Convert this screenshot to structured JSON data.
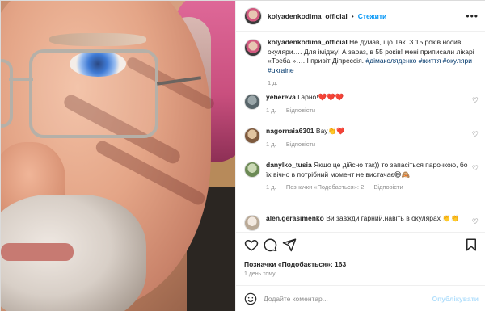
{
  "post": {
    "username": "kolyadenkodima_official",
    "follow_label": "Стежити",
    "caption_username": "kolyadenkodima_official",
    "caption_text": "Не думав, що Так. З 15 років носив окуляри…. Для іміджу! А зараз, в 55 років! мені приписали лікарі «Треба »…. І привіт Діпрессія.",
    "hashtags": "#дімаколяденко #життя #окуляри #ukraine",
    "caption_age": "1 д."
  },
  "comments": [
    {
      "username": "yehereva",
      "text": "Гарно!❤️❤️❤️",
      "age": "1 д.",
      "reply": "Відповісти"
    },
    {
      "username": "nagornaia6301",
      "text": "Вау👏❤️",
      "age": "1 д.",
      "reply": "Відповісти"
    },
    {
      "username": "danylko_tusia",
      "text": "Якщо це дійсно так)) то запасіться парочкою, бо їх вічно в потрібний момент не вистачає😅🙈",
      "age": "1 д.",
      "likes": "Позначки «Подобається»: 2",
      "reply": "Відповісти"
    },
    {
      "username": "alen.gerasimenko",
      "text": "Ви завжди гарний,навіть в окулярах 👏👏"
    }
  ],
  "footer": {
    "likes": "Позначки «Подобається»: 163",
    "ago": "1 день тому",
    "composer_placeholder": "Додайте коментар...",
    "publish_label": "Опублікувати"
  },
  "icons": {
    "more": "more-horizontal-icon",
    "like": "heart-icon",
    "comment": "comment-icon",
    "share": "share-icon",
    "save": "bookmark-icon",
    "emoji": "emoji-icon"
  },
  "colors": {
    "accent": "#0095f6",
    "hashtag": "#00376b",
    "muted": "#8e8e8e"
  }
}
